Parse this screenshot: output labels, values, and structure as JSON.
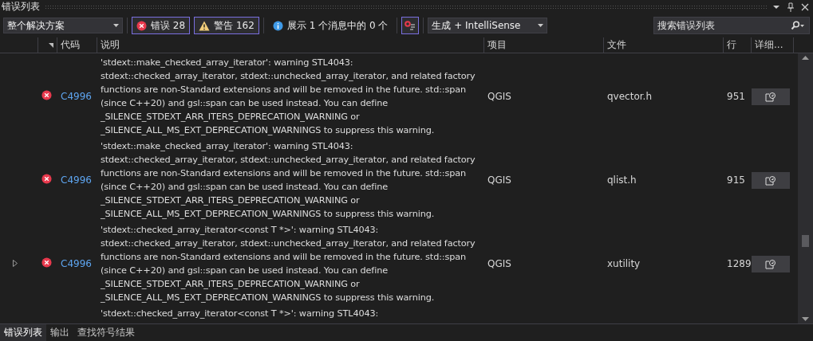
{
  "panel": {
    "title": "错误列表"
  },
  "toolbar": {
    "scope": {
      "value": "整个解决方案"
    },
    "filters": [
      {
        "kind": "error",
        "label": "错误 28",
        "selected": true
      },
      {
        "kind": "warning",
        "label": "警告 162",
        "selected": true
      },
      {
        "kind": "info",
        "label": "展示 1 个消息中的 0 个",
        "selected": false
      }
    ],
    "build_filter": {
      "selected": true
    },
    "source": {
      "value": "生成 + IntelliSense"
    },
    "search": {
      "placeholder": "搜索错误列表"
    }
  },
  "table": {
    "columns": [
      "代码",
      "说明",
      "项目",
      "文件",
      "行",
      "详细..."
    ],
    "rows": [
      {
        "expander": false,
        "kind": "error",
        "code": "C4996",
        "description": "'stdext::make_checked_array_iterator': warning STL4043:\nstdext::checked_array_iterator, stdext::unchecked_array_iterator, and related factory\nfunctions are non-Standard extensions and will be removed in the future. std::span\n(since C++20) and gsl::span can be used instead. You can define\n_SILENCE_STDEXT_ARR_ITERS_DEPRECATION_WARNING or\n_SILENCE_ALL_MS_EXT_DEPRECATION_WARNINGS to suppress this warning.",
        "project": "QGIS",
        "file": "qvector.h",
        "line": "951"
      },
      {
        "expander": false,
        "kind": "error",
        "code": "C4996",
        "description": "'stdext::make_checked_array_iterator': warning STL4043:\nstdext::checked_array_iterator, stdext::unchecked_array_iterator, and related factory\nfunctions are non-Standard extensions and will be removed in the future. std::span\n(since C++20) and gsl::span can be used instead. You can define\n_SILENCE_STDEXT_ARR_ITERS_DEPRECATION_WARNING or\n_SILENCE_ALL_MS_EXT_DEPRECATION_WARNINGS to suppress this warning.",
        "project": "QGIS",
        "file": "qlist.h",
        "line": "915"
      },
      {
        "expander": true,
        "kind": "error",
        "code": "C4996",
        "description": "'stdext::checked_array_iterator<const T *>': warning STL4043:\nstdext::checked_array_iterator, stdext::unchecked_array_iterator, and related factory\nfunctions are non-Standard extensions and will be removed in the future. std::span\n(since C++20) and gsl::span can be used instead. You can define\n_SILENCE_STDEXT_ARR_ITERS_DEPRECATION_WARNING or\n_SILENCE_ALL_MS_EXT_DEPRECATION_WARNINGS to suppress this warning.",
        "project": "QGIS",
        "file": "xutility",
        "line": "1289"
      },
      {
        "expander": false,
        "description": "'stdext::checked_array_iterator<const T *>': warning STL4043:"
      }
    ]
  },
  "bottom_tabs": [
    {
      "label": "错误列表",
      "selected": true
    },
    {
      "label": "输出",
      "selected": false
    },
    {
      "label": "查找符号结果",
      "selected": false
    }
  ]
}
